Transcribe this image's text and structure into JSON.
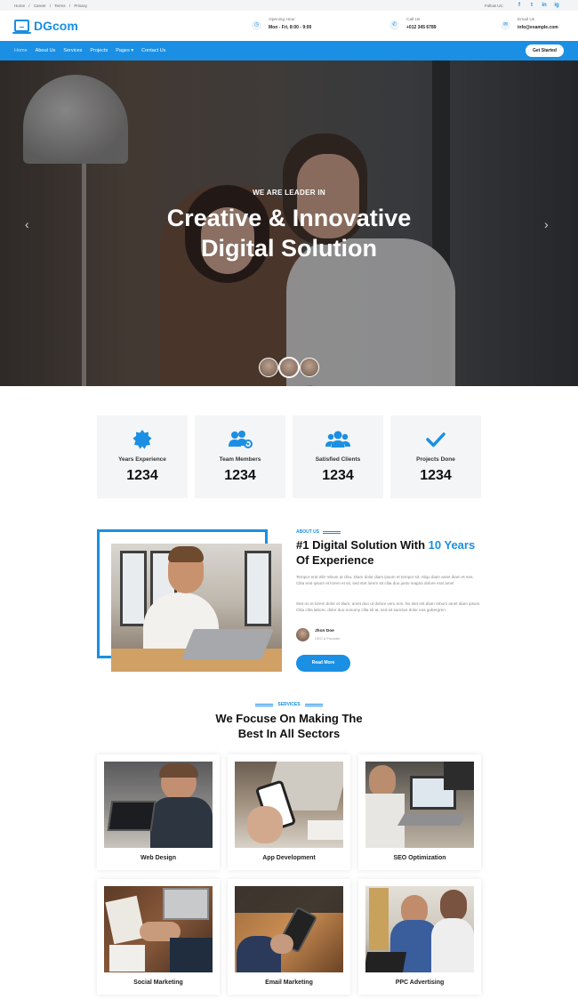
{
  "topbar": {
    "breadcrumbs": [
      "Home",
      "/",
      "Career",
      "/",
      "Terms",
      "/",
      "Privacy"
    ],
    "follow_label": "Follow Us:",
    "socials": [
      "f",
      "t",
      "in",
      "ig"
    ]
  },
  "brand": {
    "name": "DGcom"
  },
  "header": {
    "opening": {
      "label": "Opening Hour",
      "value": "Mon - Fri, 8:00 - 9:00"
    },
    "call": {
      "label": "Call Us",
      "value": "+012 345 6789"
    },
    "email": {
      "label": "Email Us",
      "value": "info@example.com"
    }
  },
  "nav": {
    "items": [
      "Home",
      "About Us",
      "Services",
      "Projects",
      "Pages ▾",
      "Contact Us"
    ],
    "cta": "Get Started"
  },
  "hero": {
    "subtitle": "WE ARE LEADER IN",
    "title_line1": "Creative & Innovative",
    "title_line2": "Digital Solution",
    "prev": "‹",
    "next": "›"
  },
  "stats": [
    {
      "label": "Years Experience",
      "value": "1234",
      "icon": "award-icon"
    },
    {
      "label": "Team Members",
      "value": "1234",
      "icon": "team-icon"
    },
    {
      "label": "Satisfied Clients",
      "value": "1234",
      "icon": "users-icon"
    },
    {
      "label": "Projects Done",
      "value": "1234",
      "icon": "check-icon"
    }
  ],
  "about": {
    "label": "ABOUT US",
    "title_pre": "#1 Digital Solution With ",
    "title_highlight": "10 Years",
    "title_post": " Of Experience",
    "para1": "Tempor erat elitr rebum at clita. Diam dolor diam ipsum et tempor sit. Aliqu diam amet diam et eos. Clita erat ipsum et lorem et sit, sed stet lorem sit clita duo justo magna dolore erat amet",
    "para2": "Stet no et lorem dolor et diam, amet duo ut dolore vero eos. No stet est diam rebum amet diam ipsum. Clita clita labore, dolor duo nonumy clita sit at, sed sit sanctus dolor eos gubergren.",
    "author_name": "Jhon Doe",
    "author_role": "CEO & Founder",
    "button": "Read More"
  },
  "services": {
    "label": "SERVICES",
    "title_line1": "We Focuse On Making The",
    "title_line2": "Best In All Sectors",
    "items": [
      "Web Design",
      "App Development",
      "SEO Optimization",
      "Social Marketing",
      "Email Marketing",
      "PPC Advertising"
    ]
  },
  "colors": {
    "accent": "#1a8fe3",
    "stat_bg": "#f4f5f7"
  }
}
